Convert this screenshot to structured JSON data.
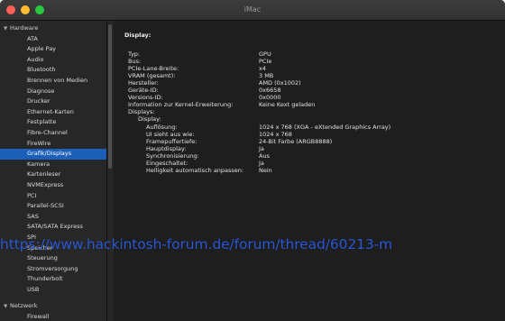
{
  "window": {
    "title": "iMac"
  },
  "sidebar": {
    "sections": [
      {
        "label": "Hardware",
        "expanded": true
      },
      {
        "label": "Netzwerk",
        "expanded": true
      }
    ],
    "items": [
      {
        "label": "ATA"
      },
      {
        "label": "Apple Pay"
      },
      {
        "label": "Audio"
      },
      {
        "label": "Bluetooth"
      },
      {
        "label": "Brennen von Medien"
      },
      {
        "label": "Diagnose"
      },
      {
        "label": "Drucker"
      },
      {
        "label": "Ethernet-Karten"
      },
      {
        "label": "Festplatte"
      },
      {
        "label": "Fibre-Channel"
      },
      {
        "label": "FireWire"
      },
      {
        "label": "Grafik/Displays",
        "selected": true
      },
      {
        "label": "Kamera"
      },
      {
        "label": "Kartenleser"
      },
      {
        "label": "NVMExpress"
      },
      {
        "label": "PCI"
      },
      {
        "label": "Parallel-SCSI"
      },
      {
        "label": "SAS"
      },
      {
        "label": "SATA/SATA Express"
      },
      {
        "label": "SPI"
      },
      {
        "label": "Speicher"
      },
      {
        "label": "Steuerung"
      },
      {
        "label": "Stromversorgung"
      },
      {
        "label": "Thunderbolt"
      },
      {
        "label": "USB"
      }
    ],
    "network_items": [
      {
        "label": "Firewall"
      }
    ]
  },
  "detail": {
    "heading": "Display:",
    "properties": [
      {
        "key": "Typ:",
        "value": "GPU"
      },
      {
        "key": "Bus:",
        "value": "PCIe"
      },
      {
        "key": "PCIe-Lane-Breite:",
        "value": "x4"
      },
      {
        "key": "VRAM (gesamt):",
        "value": "3 MB"
      },
      {
        "key": "Hersteller:",
        "value": "AMD (0x1002)"
      },
      {
        "key": "Geräte-ID:",
        "value": "0x6658"
      },
      {
        "key": "Versions-ID:",
        "value": "0x0000"
      },
      {
        "key": "Information zur Kernel-Erweiterung:",
        "value": "Keine Kext geladen"
      },
      {
        "key": "Displays:",
        "value": ""
      }
    ],
    "display_group_label": "Display:",
    "display_properties": [
      {
        "key": "Auflösung:",
        "value": "1024 x 768 (XGA - eXtended Graphics Array)"
      },
      {
        "key": "UI sieht aus wie:",
        "value": "1024 x 768"
      },
      {
        "key": "Framepuffertiefe:",
        "value": "24-Bit Farbe (ARGB8888)"
      },
      {
        "key": "Hauptdisplay:",
        "value": "Ja"
      },
      {
        "key": "Synchronisierung:",
        "value": "Aus"
      },
      {
        "key": "Eingeschaltet:",
        "value": "Ja"
      },
      {
        "key": "Helligkeit automatisch anpassen:",
        "value": "Nein"
      }
    ]
  },
  "watermark": {
    "text": "https://www.hackintosh-forum.de/forum/thread/60213-m"
  },
  "colors": {
    "selection": "#1b5fb8",
    "watermark": "#2a58d6",
    "background": "#1e1e1e"
  }
}
